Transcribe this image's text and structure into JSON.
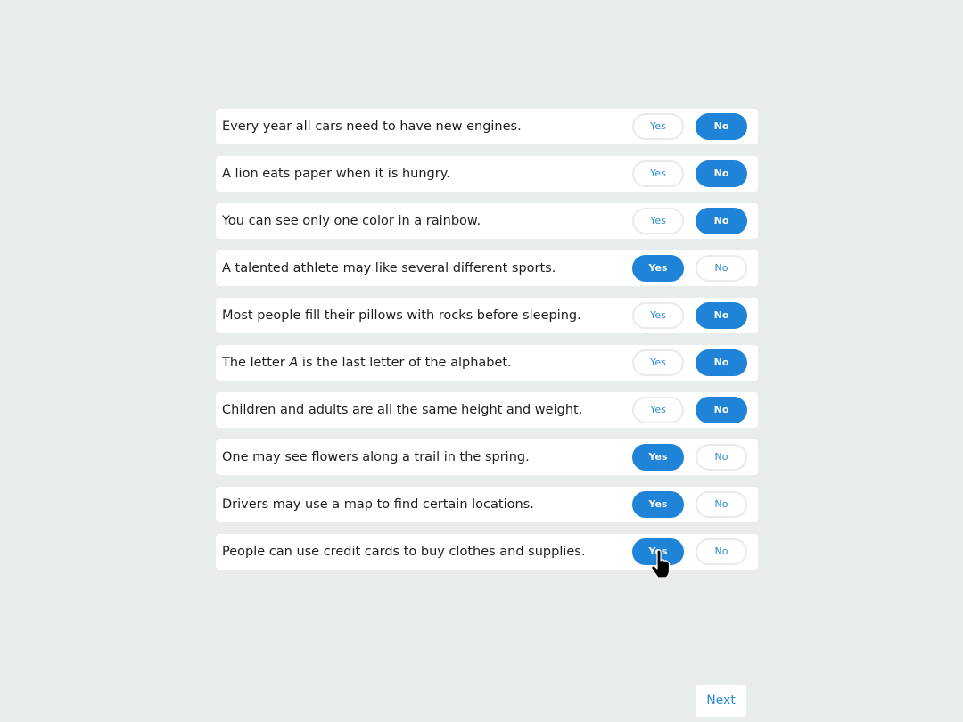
{
  "quiz": {
    "yes_label": "Yes",
    "no_label": "No",
    "items": [
      {
        "before": "Every year all cars need to have new engines.",
        "answer": "No"
      },
      {
        "before": "A lion eats paper when it is hungry.",
        "answer": "No"
      },
      {
        "before": "You can see only one color in a rainbow.",
        "answer": "No"
      },
      {
        "before": "A talented athlete may like several different sports.",
        "answer": "Yes"
      },
      {
        "before": "Most people fill their pillows with rocks before sleeping.",
        "answer": "No"
      },
      {
        "before": "The letter ",
        "emphasis": "A",
        "after": " is the last letter of the alphabet.",
        "answer": "No"
      },
      {
        "before": "Children and adults are all the same height and weight.",
        "answer": "No"
      },
      {
        "before": "One may see flowers along a trail in the spring.",
        "answer": "Yes"
      },
      {
        "before": "Drivers may use a map to find certain locations.",
        "answer": "Yes"
      },
      {
        "before": "People can use credit cards to buy clothes and supplies.",
        "answer": "Yes"
      }
    ]
  },
  "cursor": {
    "icon": "pointer-hand-icon"
  },
  "footer": {
    "next_label": "Next"
  },
  "colors": {
    "background": "#e9eced",
    "selected": "#1f84d8",
    "accent_text": "#2d8ad7"
  }
}
